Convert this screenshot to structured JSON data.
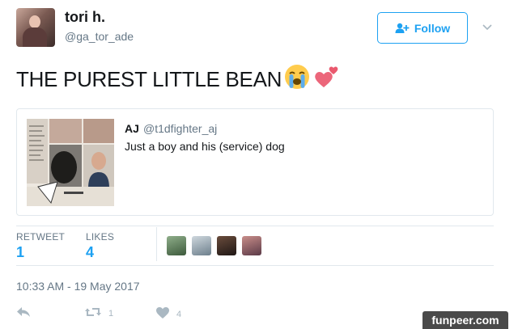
{
  "author": {
    "name": "tori h.",
    "handle": "@ga_tor_ade"
  },
  "follow_button": {
    "label": "Follow",
    "icon": "add-user-icon"
  },
  "menu": {
    "icon": "chevron-down-icon"
  },
  "tweet": {
    "text": "THE PUREST LITTLE BEAN",
    "emojis": [
      "loudly-crying-face",
      "two-hearts"
    ]
  },
  "quoted_tweet": {
    "name": "AJ",
    "handle": "@t1dfighter_aj",
    "text": "Just a boy and his (service) dog",
    "image_icon": "yearbook-photo"
  },
  "stats": {
    "retweets_label": "RETWEET",
    "retweets_value": "1",
    "likes_label": "LIKES",
    "likes_value": "4"
  },
  "timestamp": "10:33 AM - 19 May 2017",
  "actions": {
    "reply_icon": "reply-icon",
    "retweet_icon": "retweet-icon",
    "retweet_count": "1",
    "like_icon": "heart-icon",
    "like_count": "4"
  },
  "watermark": "funpeer.com",
  "colors": {
    "accent": "#1da1f2",
    "text": "#14171a",
    "muted": "#657786",
    "border": "#e1e8ed"
  }
}
